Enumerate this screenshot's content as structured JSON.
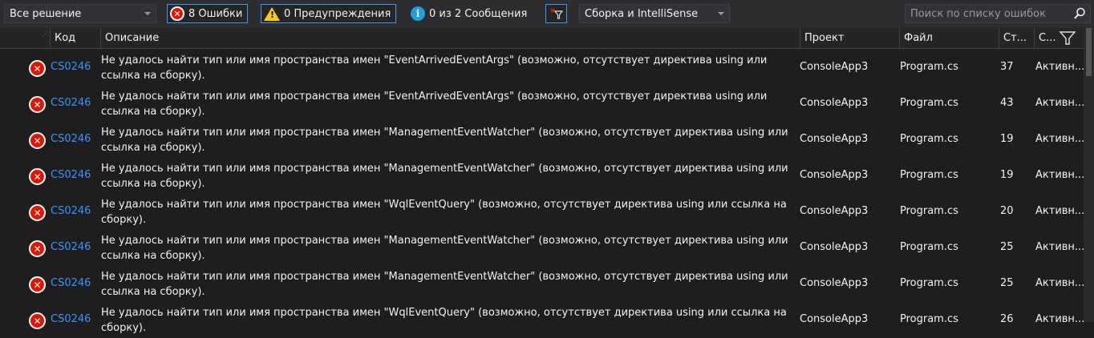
{
  "toolbar": {
    "scope": "Все решение",
    "errors_label": "8 Ошибки",
    "warnings_label": "0 Предупреждения",
    "messages_label": "0 из 2 Сообщения",
    "build_filter": "Сборка и IntelliSense",
    "search_placeholder": "Поиск по списку ошибок"
  },
  "columns": {
    "code": "Код",
    "description": "Описание",
    "project": "Проект",
    "file": "Файл",
    "line": "Ст...",
    "state": "С..."
  },
  "rows": [
    {
      "code": "CS0246",
      "description": "Не удалось найти тип или имя пространства имен \"EventArrivedEventArgs\" (возможно, отсутствует директива using или ссылка на сборку).",
      "project": "ConsoleApp3",
      "file": "Program.cs",
      "line": "37",
      "state": "Активн..."
    },
    {
      "code": "CS0246",
      "description": "Не удалось найти тип или имя пространства имен \"EventArrivedEventArgs\" (возможно, отсутствует директива using или ссылка на сборку).",
      "project": "ConsoleApp3",
      "file": "Program.cs",
      "line": "43",
      "state": "Активн..."
    },
    {
      "code": "CS0246",
      "description": "Не удалось найти тип или имя пространства имен \"ManagementEventWatcher\" (возможно, отсутствует директива using или ссылка на сборку).",
      "project": "ConsoleApp3",
      "file": "Program.cs",
      "line": "19",
      "state": "Активн..."
    },
    {
      "code": "CS0246",
      "description": "Не удалось найти тип или имя пространства имен \"ManagementEventWatcher\" (возможно, отсутствует директива using или ссылка на сборку).",
      "project": "ConsoleApp3",
      "file": "Program.cs",
      "line": "19",
      "state": "Активн..."
    },
    {
      "code": "CS0246",
      "description": "Не удалось найти тип или имя пространства имен \"WqlEventQuery\" (возможно, отсутствует директива using или ссылка на сборку).",
      "project": "ConsoleApp3",
      "file": "Program.cs",
      "line": "20",
      "state": "Активн..."
    },
    {
      "code": "CS0246",
      "description": "Не удалось найти тип или имя пространства имен \"ManagementEventWatcher\" (возможно, отсутствует директива using или ссылка на сборку).",
      "project": "ConsoleApp3",
      "file": "Program.cs",
      "line": "25",
      "state": "Активн..."
    },
    {
      "code": "CS0246",
      "description": "Не удалось найти тип или имя пространства имен \"ManagementEventWatcher\" (возможно, отсутствует директива using или ссылка на сборку).",
      "project": "ConsoleApp3",
      "file": "Program.cs",
      "line": "25",
      "state": "Активн..."
    },
    {
      "code": "CS0246",
      "description": "Не удалось найти тип или имя пространства имен \"WqlEventQuery\" (возможно, отсутствует директива using или ссылка на сборку).",
      "project": "ConsoleApp3",
      "file": "Program.cs",
      "line": "26",
      "state": "Активн..."
    }
  ],
  "icons": {
    "error": "error-circle-icon",
    "warning": "warning-triangle-icon",
    "info": "info-circle-icon",
    "filter": "filter-funnel-icon",
    "search": "search-icon"
  },
  "colors": {
    "background": "#1e1e1e",
    "error": "#e51400",
    "warning": "#ffcc00",
    "info": "#1ba1e2",
    "link": "#3794ff",
    "toggle_border": "#3399ff"
  }
}
